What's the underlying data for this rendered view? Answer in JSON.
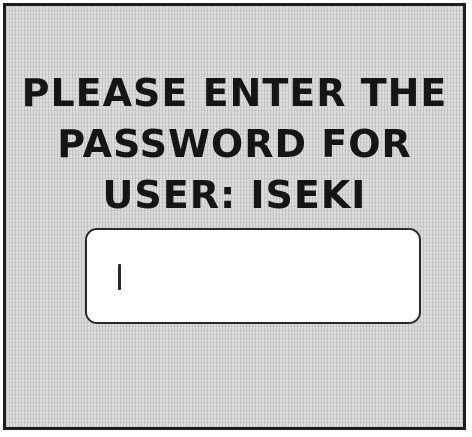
{
  "dialog": {
    "prompt_lines": [
      "PLEASE ENTER THE",
      "PASSWORD FOR",
      "USER: ISEKI"
    ],
    "password_input": {
      "value": ""
    }
  }
}
